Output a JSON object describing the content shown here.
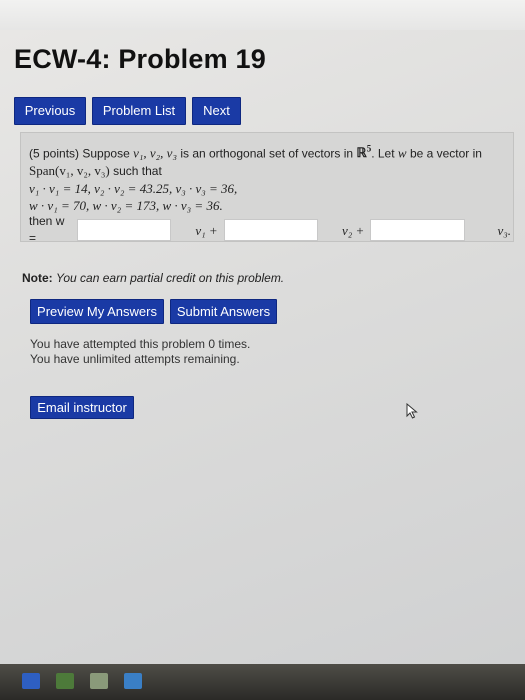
{
  "page": {
    "title": "ECW-4: Problem 19"
  },
  "nav": {
    "previous": "Previous",
    "problem_list": "Problem List",
    "next": "Next"
  },
  "problem": {
    "points": "(5 points)",
    "intro": "Suppose",
    "vectors": "v₁, v₂, v₃",
    "is_text": "is an orthogonal set of vectors in",
    "space": "ℝ",
    "space_exp": "5",
    "let_text": ". Let",
    "w": "w",
    "be_text": "be a vector in",
    "span": "Span(v₁, v₂, v₃)",
    "such_that": "such that",
    "line1": "v₁ · v₁ = 14, v₂ · v₂ = 43.25, v₃ · v₃ = 36,",
    "line2": "w · v₁ = 70, w · v₂ = 173, w · v₃ = 36.",
    "then": "then w =",
    "v1_plus": "v₁ +",
    "v2_plus": "v₂ +",
    "v3_end": "v₃."
  },
  "note": {
    "label": "Note:",
    "text": "You can earn partial credit on this problem."
  },
  "actions": {
    "preview": "Preview My Answers",
    "submit": "Submit Answers"
  },
  "attempts": {
    "line1": "You have attempted this problem 0 times.",
    "line2": "You have unlimited attempts remaining."
  },
  "email": "Email instructor",
  "colors": {
    "button": "#1a3aa5",
    "problem_bg": "#d6d6d5"
  }
}
